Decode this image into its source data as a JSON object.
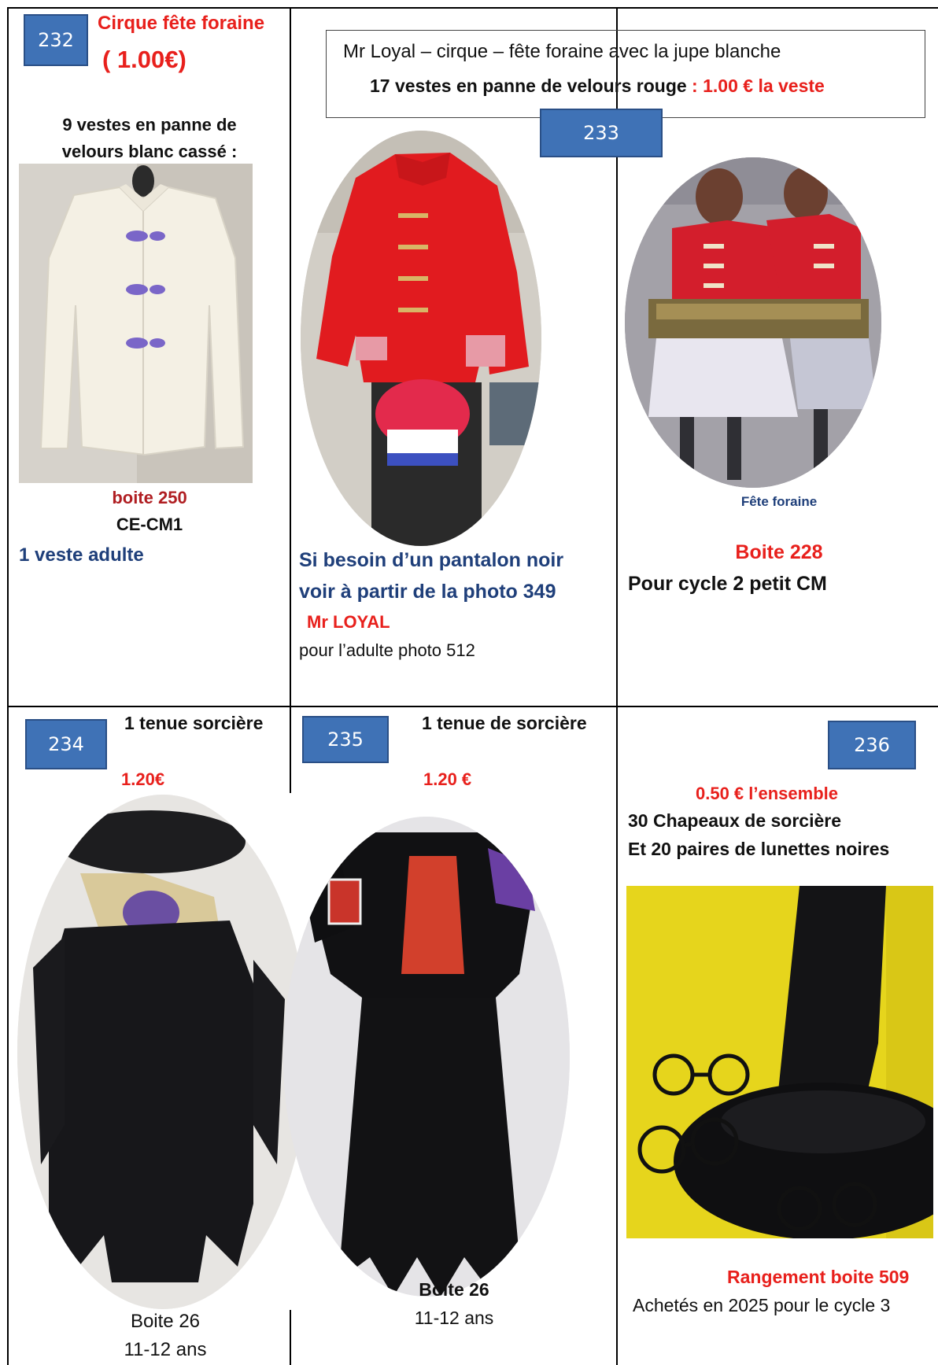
{
  "cell232": {
    "number": "232",
    "title": "Cirque fête foraine",
    "price": "( 1.00€)",
    "desc_line1": "9 vestes en panne de",
    "desc_line2": "velours blanc cassé :",
    "box": "boite 250",
    "level": "CE-CM1",
    "note": "1 veste adulte"
  },
  "header233": {
    "line1": "Mr Loyal – cirque – fête foraine avec la jupe blanche",
    "line2_part1": "17 vestes en panne de velours rouge",
    "line2_part2": " : 1.00 € la veste"
  },
  "cell233": {
    "number": "233",
    "text_line1": "Si  besoin d’un pantalon noir",
    "text_line2": "voir à partir de  la photo 349",
    "loyal": "Mr LOYAL",
    "adult": "pour l’adulte photo 512"
  },
  "cell233b": {
    "caption": "Fête foraine",
    "box": "Boite 228",
    "cycle": "Pour cycle 2 petit CM"
  },
  "cell234": {
    "number": "234",
    "title": "1 tenue sorcière",
    "price": "1.20€",
    "box": "Boite 26",
    "age": "11-12 ans"
  },
  "cell235": {
    "number": "235",
    "title": "1 tenue de sorcière",
    "price": "1.20 €",
    "box": "Boite 26",
    "age": "11-12 ans"
  },
  "cell236": {
    "number": "236",
    "price": "0.50 € l’ensemble",
    "line1": "30 Chapeaux de sorcière",
    "line2": "Et 20 paires de lunettes noires",
    "box": "Rangement boite 509",
    "bought": "Achetés en 2025 pour le cycle 3"
  },
  "colors": {
    "badge": "#3f72b6",
    "red": "#e8201c",
    "dark_red": "#b01e22",
    "navy": "#1f3f7a"
  }
}
